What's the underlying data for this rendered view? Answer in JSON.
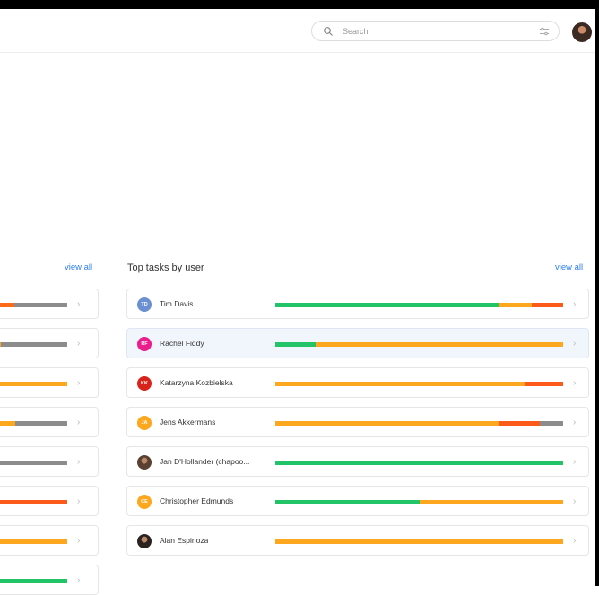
{
  "header": {
    "search": {
      "placeholder": "Search"
    }
  },
  "left_panel": {
    "view_all": "view all",
    "rows": [
      {
        "segments": [
          {
            "color": "#fc6a1a",
            "w": 0.26
          },
          {
            "color": "#8c8c8c",
            "w": 0.74
          }
        ]
      },
      {
        "segments": [
          {
            "color": "#fca71e",
            "w": 0.07
          },
          {
            "color": "#8c8c8c",
            "w": 0.93
          }
        ]
      },
      {
        "segments": [
          {
            "color": "#fca71e",
            "w": 1.0
          }
        ]
      },
      {
        "segments": [
          {
            "color": "#fca71e",
            "w": 0.28
          },
          {
            "color": "#8c8c8c",
            "w": 0.72
          }
        ]
      },
      {
        "segments": [
          {
            "color": "#8c8c8c",
            "w": 1.0
          }
        ]
      },
      {
        "segments": [
          {
            "color": "#fc5a1a",
            "w": 1.0
          }
        ]
      },
      {
        "segments": [
          {
            "color": "#fca71e",
            "w": 1.0
          }
        ]
      },
      {
        "segments": [
          {
            "color": "#22c467",
            "w": 1.0
          }
        ]
      }
    ]
  },
  "right_panel": {
    "title": "Top tasks by user",
    "view_all": "view all",
    "users": [
      {
        "name": "Tim Davis",
        "initials": "TD",
        "avatar_color": "#6b8fd1",
        "segments": [
          {
            "color": "#22c467",
            "w": 0.78
          },
          {
            "color": "#fca71e",
            "w": 0.11
          },
          {
            "color": "#fc5a1a",
            "w": 0.11
          }
        ]
      },
      {
        "name": "Rachel Fiddy",
        "initials": "RF",
        "avatar_color": "#e91e8c",
        "segments": [
          {
            "color": "#22c467",
            "w": 0.14
          },
          {
            "color": "#fca71e",
            "w": 0.86
          }
        ]
      },
      {
        "name": "Katarzyna Kozbielska",
        "initials": "KK",
        "avatar_color": "#d8231b",
        "segments": [
          {
            "color": "#fca71e",
            "w": 0.87
          },
          {
            "color": "#fc5a1a",
            "w": 0.13
          }
        ]
      },
      {
        "name": "Jens Akkermans",
        "initials": "JA",
        "avatar_color": "#fca71e",
        "segments": [
          {
            "color": "#fca71e",
            "w": 0.78
          },
          {
            "color": "#fc5a1a",
            "w": 0.14
          },
          {
            "color": "#8c8c8c",
            "w": 0.08
          }
        ]
      },
      {
        "name": "Jan D'Hollander (chapoo...",
        "initials": "",
        "avatar_color": "#5a4030",
        "photo": true,
        "segments": [
          {
            "color": "#22c467",
            "w": 1.0
          }
        ]
      },
      {
        "name": "Christopher Edmunds",
        "initials": "CE",
        "avatar_color": "#fca71e",
        "segments": [
          {
            "color": "#22c467",
            "w": 0.5
          },
          {
            "color": "#fca71e",
            "w": 0.5
          }
        ]
      },
      {
        "name": "Alan Espinoza",
        "initials": "",
        "avatar_color": "#2c2320",
        "photo": true,
        "segments": [
          {
            "color": "#fca71e",
            "w": 1.0
          }
        ]
      }
    ]
  }
}
